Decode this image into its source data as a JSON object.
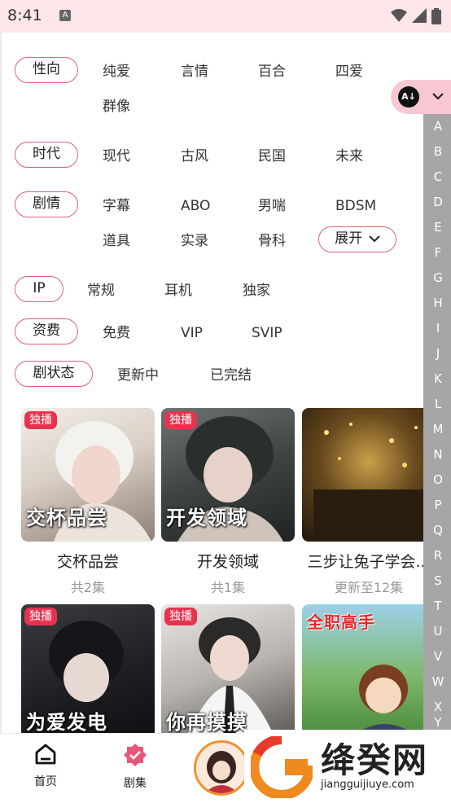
{
  "status": {
    "time": "8:41",
    "indicator": "A"
  },
  "filters": {
    "orientation": {
      "label": "性向",
      "options": [
        "纯爱",
        "言情",
        "百合",
        "四爱",
        "群像"
      ]
    },
    "era": {
      "label": "时代",
      "options": [
        "现代",
        "古风",
        "民国",
        "未来"
      ]
    },
    "plot": {
      "label": "剧情",
      "options": [
        "字幕",
        "ABO",
        "男喘",
        "BDSM",
        "道具",
        "实录",
        "骨科"
      ],
      "expand": "展开"
    },
    "ip": {
      "label": "IP",
      "options": [
        "常规",
        "耳机",
        "独家"
      ]
    },
    "fee": {
      "label": "资费",
      "options": [
        "免费",
        "VIP",
        "SVIP"
      ]
    },
    "state": {
      "label": "剧状态",
      "options": [
        "更新中",
        "已完结"
      ]
    }
  },
  "sort": {
    "icon": "sort-az-icon",
    "dropdown_icon": "chevron-down-icon"
  },
  "index_letters": [
    "A",
    "B",
    "C",
    "D",
    "E",
    "F",
    "G",
    "H",
    "I",
    "J",
    "K",
    "L",
    "M",
    "N",
    "O",
    "P",
    "Q",
    "R",
    "S",
    "T",
    "U",
    "V",
    "W",
    "X",
    "Y"
  ],
  "cards": [
    {
      "badge": "独播",
      "cover_title": "交杯品尝",
      "title": "交杯品尝",
      "sub": "共2集"
    },
    {
      "badge": "独播",
      "cover_title": "开发领域",
      "title": "开发领域",
      "sub": "共1集"
    },
    {
      "badge": "",
      "cover_title": "",
      "title": "三步让兔子学会...",
      "sub": "更新至12集"
    },
    {
      "badge": "独播",
      "cover_title": "为爱发电",
      "title": "",
      "sub": ""
    },
    {
      "badge": "独播",
      "cover_title": "你再摸摸",
      "title": "",
      "sub": ""
    },
    {
      "badge": "",
      "cover_title": "全职高手",
      "title": "",
      "sub": ""
    }
  ],
  "nav": {
    "home": "首页",
    "drama": "剧集"
  },
  "watermark": {
    "name": "绛癸网",
    "url": "jiangguijiuye.com"
  },
  "colors": {
    "accent": "#e0607a",
    "badge": "#e8334f",
    "status_bg": "#fde6ea",
    "index_bg": "#a6a6a6"
  }
}
